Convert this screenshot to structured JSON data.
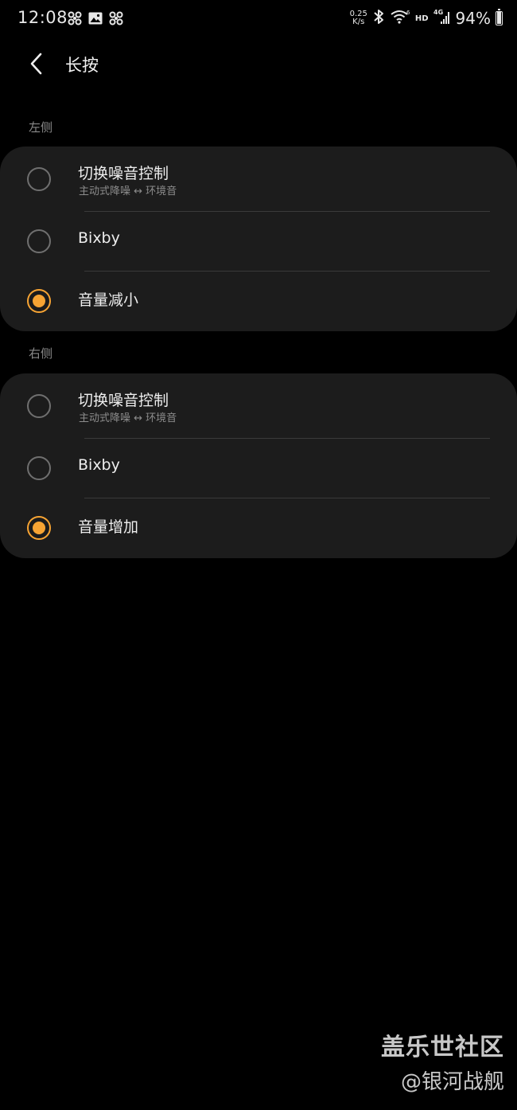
{
  "status_bar": {
    "time": "12:08",
    "net_speed_value": "0.25",
    "net_speed_unit": "K/s",
    "network_type": "4G",
    "hd_label": "HD",
    "battery_text": "94%",
    "battery_level": 0.94,
    "left_icons": [
      "fan-icon",
      "gallery-icon",
      "fan-icon"
    ],
    "right_icons": [
      "bluetooth-icon",
      "wifi-icon",
      "signal-icon",
      "battery-icon"
    ]
  },
  "header": {
    "back_icon": "chevron-left-icon",
    "title": "长按"
  },
  "sections": [
    {
      "label": "左侧",
      "options": [
        {
          "label": "切换噪音控制",
          "sub": "主动式降噪 ↔ 环境音",
          "checked": false
        },
        {
          "label": "Bixby",
          "sub": "",
          "checked": false
        },
        {
          "label": "音量减小",
          "sub": "",
          "checked": true
        }
      ]
    },
    {
      "label": "右侧",
      "options": [
        {
          "label": "切换噪音控制",
          "sub": "主动式降噪 ↔ 环境音",
          "checked": false
        },
        {
          "label": "Bixby",
          "sub": "",
          "checked": false
        },
        {
          "label": "音量增加",
          "sub": "",
          "checked": true
        }
      ]
    }
  ],
  "watermark": {
    "title": "盖乐世社区",
    "user": "@银河战舰"
  },
  "colors": {
    "accent": "#f7a433",
    "card": "#1c1c1c",
    "background": "#000000"
  }
}
